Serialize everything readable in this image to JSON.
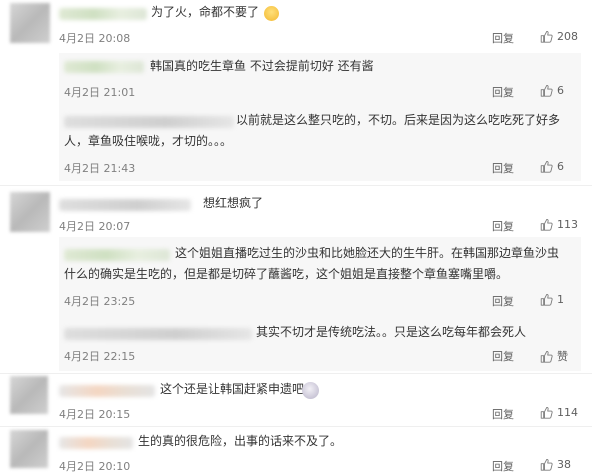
{
  "labels": {
    "reply": "回复",
    "like_word": "赞"
  },
  "comments": [
    {
      "text": "为了火，命都不要了",
      "time": "4月2日 20:08",
      "likes": "208"
    },
    {
      "text": "韩国真的吃生章鱼 不过会提前切好  还有酱",
      "time": "4月2日 21:01",
      "likes": "6"
    },
    {
      "lines": [
        "以前就是这么整只吃的，不切。后来是因为这么吃吃死了好多",
        "人，章鱼吸住喉咙，才切的。。。"
      ],
      "time": "4月2日 21:43",
      "likes": "6"
    },
    {
      "text": "想红想疯了",
      "time": "4月2日 20:07",
      "likes": "113"
    },
    {
      "lines": [
        "这个姐姐直播吃过生的沙虫和比她脸还大的生牛肝。在韩国那边章鱼沙虫",
        "什么的确实是生吃的，但是都是切碎了蘸酱吃，这个姐姐是直接整个章鱼塞嘴里嚼。"
      ],
      "time": "4月2日 23:25",
      "likes": "1"
    },
    {
      "text": "其实不切才是传统吃法。。只是这么吃每年都会死人",
      "time": "4月2日 22:15",
      "likes": ""
    },
    {
      "text": "这个还是让韩国赶紧申遗吧",
      "time": "4月2日 20:15",
      "likes": "114"
    },
    {
      "text": "生的真的很危险，出事的话来不及了。",
      "time": "4月2日 20:10",
      "likes": "38"
    }
  ]
}
